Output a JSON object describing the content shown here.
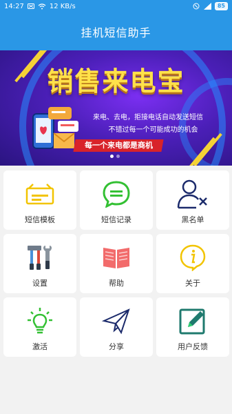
{
  "status": {
    "time": "14:27",
    "speed": "12 KB/s",
    "battery": "85"
  },
  "header": {
    "title": "挂机短信助手"
  },
  "banner": {
    "title": "销售来电宝",
    "line1": "来电、去电，拒接电话自动发送短信",
    "line2": "不错过每一个可能成功的机会",
    "ribbon": "每一个来电都是商机"
  },
  "menu": {
    "items": [
      {
        "label": "短信模板",
        "icon": "sms-template-icon"
      },
      {
        "label": "短信记录",
        "icon": "sms-record-icon"
      },
      {
        "label": "黑名单",
        "icon": "blacklist-icon"
      },
      {
        "label": "设置",
        "icon": "tools-icon"
      },
      {
        "label": "帮助",
        "icon": "book-icon"
      },
      {
        "label": "关于",
        "icon": "info-icon"
      },
      {
        "label": "激活",
        "icon": "lightbulb-icon"
      },
      {
        "label": "分享",
        "icon": "paper-plane-icon"
      },
      {
        "label": "用户反馈",
        "icon": "edit-icon"
      }
    ]
  },
  "colors": {
    "primary": "#2a97e6",
    "accent_yellow": "#ffe14a",
    "green": "#33cc33"
  }
}
